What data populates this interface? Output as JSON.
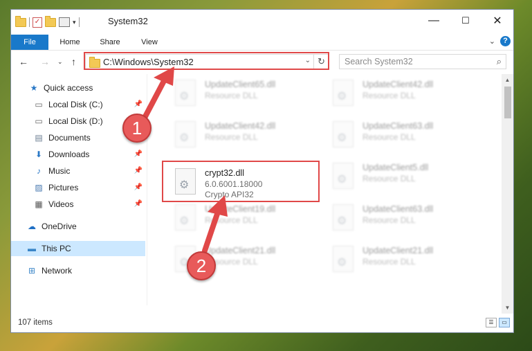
{
  "window": {
    "title": "System32",
    "controls": {
      "minimize": "—",
      "maximize": "☐",
      "close": "✕"
    }
  },
  "ribbon": {
    "tabs": [
      "File",
      "Home",
      "Share",
      "View"
    ],
    "help": "?"
  },
  "nav": {
    "address": "C:\\Windows\\System32",
    "search_placeholder": "Search System32"
  },
  "sidebar": {
    "items": [
      {
        "label": "Quick access",
        "icon": "star-icon"
      },
      {
        "label": "Local Disk (C:)",
        "icon": "drive-icon",
        "pinned": true
      },
      {
        "label": "Local Disk (D:)",
        "icon": "drive-icon"
      },
      {
        "label": "Documents",
        "icon": "documents-icon"
      },
      {
        "label": "Downloads",
        "icon": "download-icon",
        "pinned": true
      },
      {
        "label": "Music",
        "icon": "music-icon",
        "pinned": true
      },
      {
        "label": "Pictures",
        "icon": "pictures-icon",
        "pinned": true
      },
      {
        "label": "Videos",
        "icon": "videos-icon",
        "pinned": true
      },
      {
        "label": "OneDrive",
        "icon": "cloud-icon"
      },
      {
        "label": "This PC",
        "icon": "computer-icon",
        "selected": true
      },
      {
        "label": "Network",
        "icon": "network-icon"
      }
    ]
  },
  "files": [
    {
      "name": "UpdateClient65.dll",
      "type": "Resource DLL"
    },
    {
      "name": "UpdateClient42.dll",
      "type": "Resource DLL"
    },
    {
      "name": "UpdateClient42.dll",
      "type": "Resource DLL"
    },
    {
      "name": "UpdateClient63.dll",
      "type": "Resource DLL"
    },
    {
      "name": "crypt32.dll",
      "version": "6.0.6001.18000",
      "type": "Crypto API32"
    },
    {
      "name": "UpdateClient5.dll",
      "type": "Resource DLL"
    },
    {
      "name": "UpdateClient19.dll",
      "type": "Resource DLL"
    },
    {
      "name": "UpdateClient63.dll",
      "type": "Resource DLL"
    },
    {
      "name": "UpdateClient21.dll",
      "type": "Resource DLL"
    },
    {
      "name": "UpdateClient21.dll",
      "type": "Resource DLL"
    }
  ],
  "status": {
    "count": "107 items"
  },
  "annotations": {
    "step1": "1",
    "step2": "2",
    "color": "#e04848"
  }
}
